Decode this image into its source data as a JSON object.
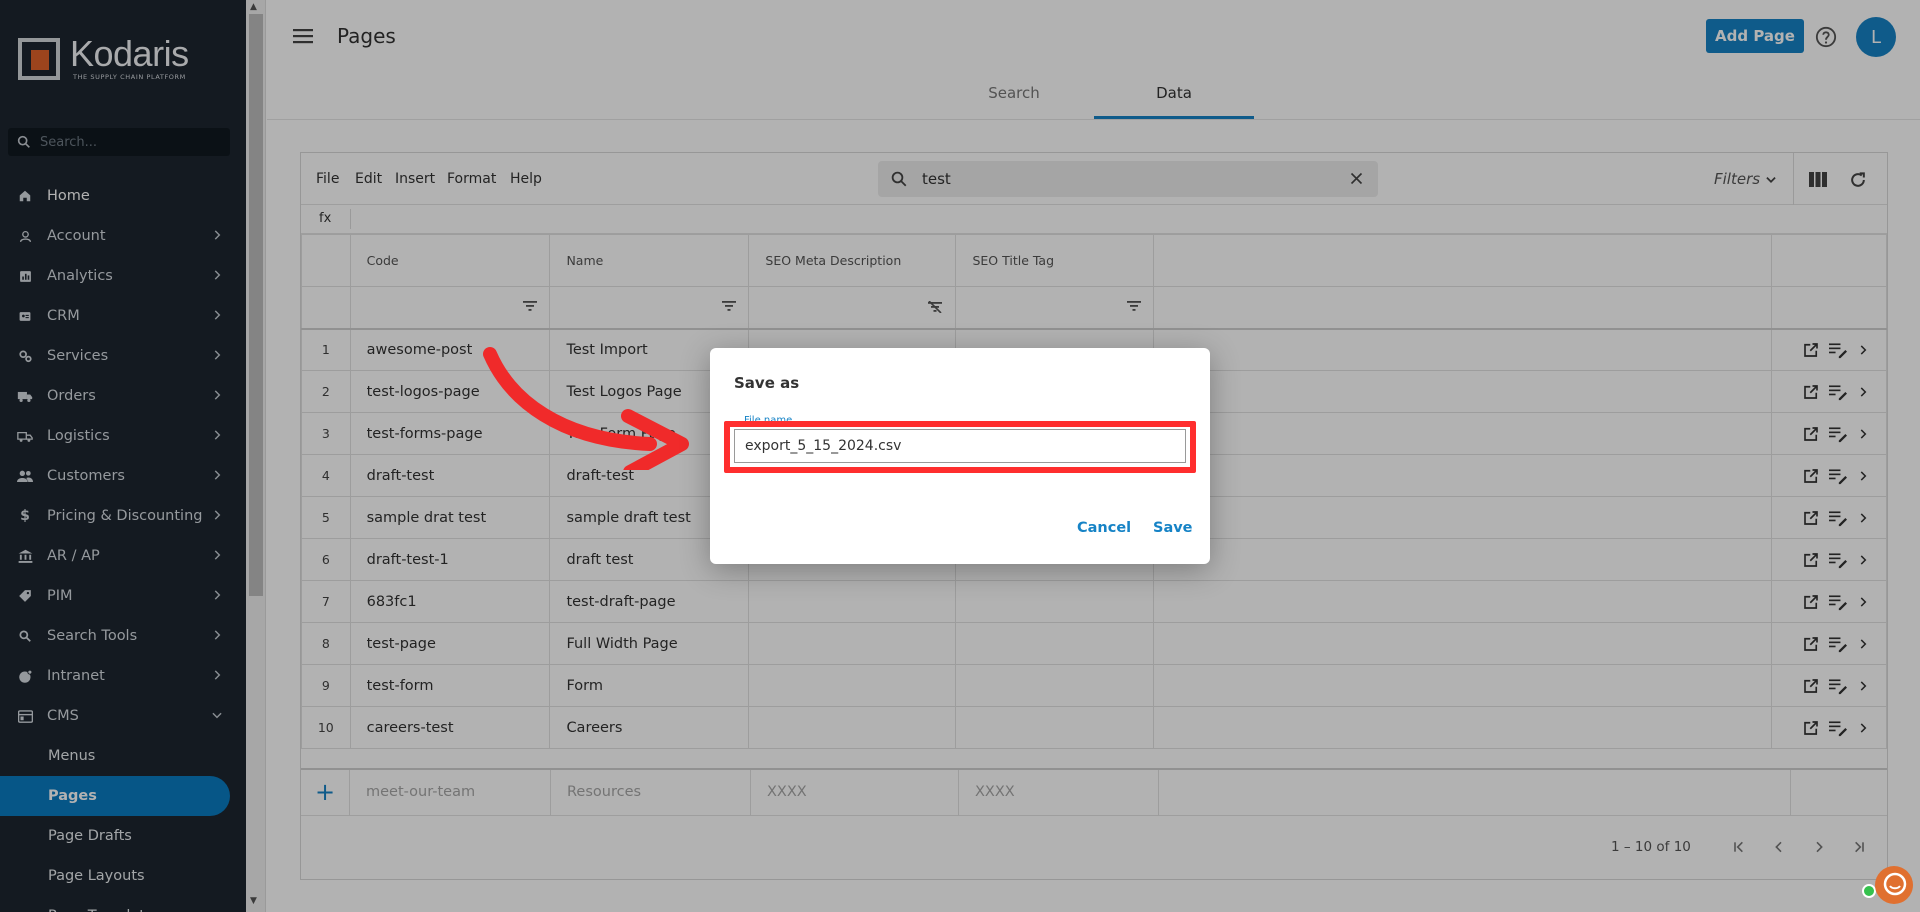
{
  "sidebar": {
    "logo": {
      "name": "Kodaris",
      "tagline": "THE SUPPLY CHAIN PLATFORM"
    },
    "search_placeholder": "Search...",
    "items": [
      {
        "label": "Home",
        "icon": "home-icon"
      },
      {
        "label": "Account",
        "icon": "person-icon"
      },
      {
        "label": "Analytics",
        "icon": "analytics-icon"
      },
      {
        "label": "CRM",
        "icon": "contact-card-icon"
      },
      {
        "label": "Services",
        "icon": "gears-icon"
      },
      {
        "label": "Orders",
        "icon": "truck-icon"
      },
      {
        "label": "Logistics",
        "icon": "shipping-icon"
      },
      {
        "label": "Customers",
        "icon": "people-icon"
      },
      {
        "label": "Pricing & Discounting",
        "icon": "dollar-icon"
      },
      {
        "label": "AR / AP",
        "icon": "bank-icon"
      },
      {
        "label": "PIM",
        "icon": "tag-icon"
      },
      {
        "label": "Search Tools",
        "icon": "search-icon"
      },
      {
        "label": "Intranet",
        "icon": "globe-icon"
      },
      {
        "label": "CMS",
        "icon": "web-icon"
      }
    ],
    "cms_sub": [
      "Menus",
      "Pages",
      "Page Drafts",
      "Page Layouts",
      "Page Templates"
    ]
  },
  "header": {
    "title": "Pages",
    "add_button": "Add Page",
    "avatar_initial": "L",
    "tabs": [
      "Search",
      "Data"
    ]
  },
  "grid": {
    "menus": [
      "File",
      "Edit",
      "Insert",
      "Format",
      "Help"
    ],
    "search_value": "test",
    "filters_label": "Filters",
    "fx_label": "fx",
    "columns": [
      "Code",
      "Name",
      "SEO Meta Description",
      "SEO Title Tag"
    ],
    "rows": [
      {
        "n": "1",
        "code": "awesome-post",
        "name": "Test Import"
      },
      {
        "n": "2",
        "code": "test-logos-page",
        "name": "Test Logos Page"
      },
      {
        "n": "3",
        "code": "test-forms-page",
        "name": "Test Form Page"
      },
      {
        "n": "4",
        "code": "draft-test",
        "name": "draft-test"
      },
      {
        "n": "5",
        "code": "sample drat test",
        "name": "sample draft test"
      },
      {
        "n": "6",
        "code": "draft-test-1",
        "name": "draft test"
      },
      {
        "n": "7",
        "code": "683fc1",
        "name": "test-draft-page"
      },
      {
        "n": "8",
        "code": "test-page",
        "name": "Full Width Page"
      },
      {
        "n": "9",
        "code": "test-form",
        "name": "Form"
      },
      {
        "n": "10",
        "code": "careers-test",
        "name": "Careers"
      }
    ],
    "new_row": {
      "code": "meet-our-team",
      "name": "Resources",
      "seo_meta": "XXXX",
      "seo_title": "XXXX"
    },
    "pager_text": "1 – 10 of 10"
  },
  "dialog": {
    "title": "Save as",
    "field_label": "File name",
    "file_name": "export_5_15_2024.csv",
    "cancel": "Cancel",
    "save": "Save"
  },
  "colors": {
    "accent": "#1683c6",
    "sidebar_bg": "#1d2630",
    "highlight": "#ff2e2e",
    "arrow": "#f02a2a"
  }
}
